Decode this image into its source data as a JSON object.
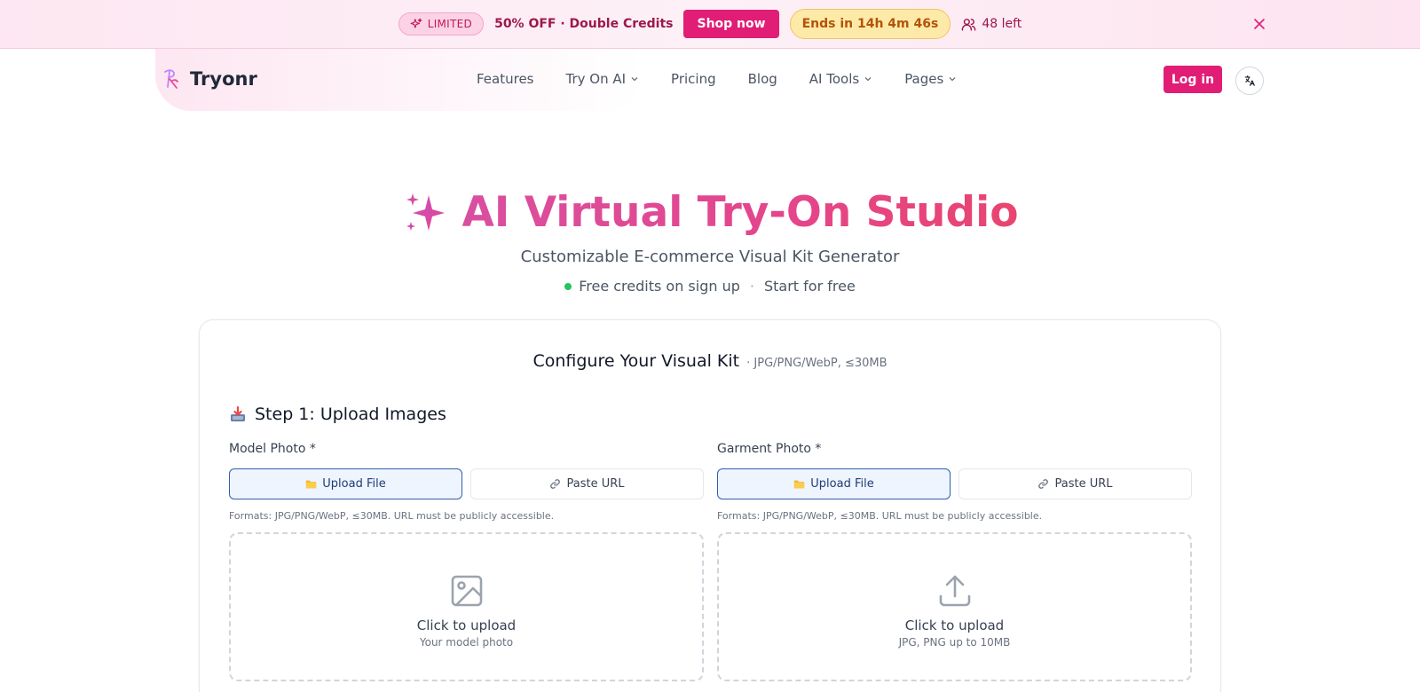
{
  "promo": {
    "badge": "LIMITED",
    "text": "50% OFF · Double Credits",
    "cta": "Shop now",
    "timer": "Ends in 14h 4m 46s",
    "left": "48 left"
  },
  "header": {
    "logo": "Tryonr",
    "nav": [
      {
        "label": "Features"
      },
      {
        "label": "Try On AI"
      },
      {
        "label": "Pricing"
      },
      {
        "label": "Blog"
      },
      {
        "label": "AI Tools"
      },
      {
        "label": "Pages"
      }
    ],
    "login": "Log in"
  },
  "hero": {
    "title": "AI Virtual Try-On Studio",
    "subtitle": "Customizable E-commerce Visual Kit Generator",
    "note1": "Free credits on sign up",
    "separator": "·",
    "note2": "Start for free"
  },
  "card": {
    "title": "Configure Your Visual Kit",
    "subtitle": "· JPG/PNG/WebP, ≤30MB",
    "step1": "Step 1: Upload Images",
    "model": {
      "label": "Model Photo *",
      "upload": "Upload File",
      "paste": "Paste URL",
      "hint": "Formats: JPG/PNG/WebP, ≤30MB. URL must be publicly accessible.",
      "dz_title": "Click to upload",
      "dz_sub": "Your model photo"
    },
    "garment": {
      "label": "Garment Photo *",
      "upload": "Upload File",
      "paste": "Paste URL",
      "hint": "Formats: JPG/PNG/WebP, ≤30MB. URL must be publicly accessible.",
      "dz_title": "Click to upload",
      "dz_sub": "JPG, PNG up to 10MB"
    }
  },
  "colors": {
    "brand": "#e11d75",
    "title_gradient_start": "#d94fa0",
    "title_gradient_end": "#e8456f",
    "active_border": "#2f5fa8",
    "status_green": "#22c55e"
  }
}
